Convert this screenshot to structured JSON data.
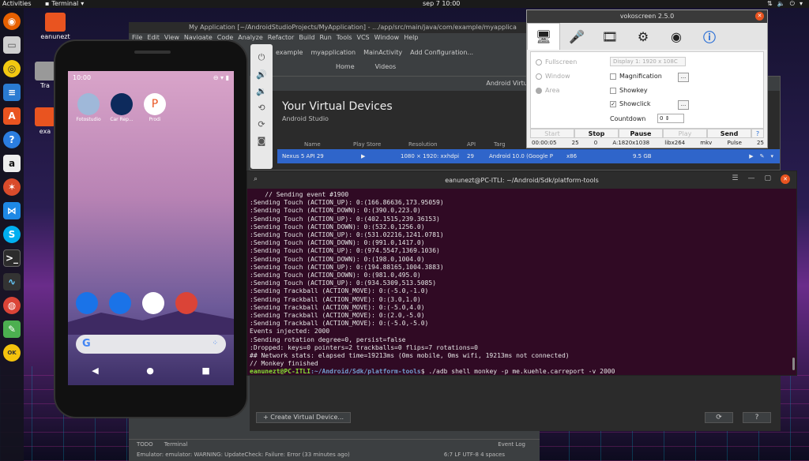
{
  "topbar": {
    "activities": "Activities",
    "terminal_menu": "Terminal",
    "clock": "sep 7  10:00"
  },
  "dock": {
    "items": [
      "firefox",
      "files",
      "rhythmbox",
      "libreoffice-writer",
      "ubuntu-software",
      "help",
      "amazon",
      "gitkraken",
      "vscode",
      "skype",
      "terminal",
      "system-monitor",
      "chrome",
      "notes",
      "whoami"
    ]
  },
  "desktop_icons": {
    "eanunezt": "eanunezt",
    "trash": "Tra",
    "exa": "exa"
  },
  "studio": {
    "title": "My Application [~/AndroidStudioProjects/MyApplication] - .../app/src/main/java/com/example/myapplica",
    "menu": [
      "File",
      "Edit",
      "View",
      "Navigate",
      "Code",
      "Analyze",
      "Refactor",
      "Build",
      "Run",
      "Tools",
      "VCS",
      "Window",
      "Help"
    ],
    "breadcrumb": [
      "example",
      "myapplication",
      "MainActivity",
      "Add Configuration..."
    ],
    "nav": [
      "Home",
      "Videos"
    ],
    "bottom_tabs": [
      "TODO",
      "Terminal"
    ],
    "event_log": "Event Log",
    "status_text": "Emulator: emulator: WARNING: UpdateCheck: Failure: Error (33 minutes ago)",
    "status_right": "6:7  LF  UTF-8  4 spaces"
  },
  "avd": {
    "window_title": "Android Virtual De",
    "heading": "Your Virtual Devices",
    "subheading": "Android Studio",
    "columns": [
      "Name",
      "Play Store",
      "Resolution",
      "API",
      "Targ"
    ],
    "row": {
      "name": "Nexus 5 API 29",
      "resolution": "1080 × 1920: xxhdpi",
      "api": "29",
      "target": "Android 10.0 (Google P",
      "cpu": "x86",
      "size": "9.5 GB"
    },
    "create_button": "+ Create Virtual Device..."
  },
  "phone": {
    "time": "10:00",
    "apps": [
      {
        "label": "Fotostudio"
      },
      {
        "label": "Car Rep..."
      },
      {
        "label": "Prodi"
      }
    ]
  },
  "terminal": {
    "title": "eanunezt@PC-ITLI: ~/Android/Sdk/platform-tools",
    "lines": [
      "    // Sending event #1900",
      ":Sending Touch (ACTION_UP): 0:(166.86636,173.95059)",
      ":Sending Touch (ACTION_DOWN): 0:(390.0,223.0)",
      ":Sending Touch (ACTION_UP): 0:(402.1515,239.36153)",
      ":Sending Touch (ACTION_DOWN): 0:(532.0,1256.0)",
      ":Sending Touch (ACTION_UP): 0:(531.02216,1241.0781)",
      ":Sending Touch (ACTION_DOWN): 0:(991.0,1417.0)",
      ":Sending Touch (ACTION_UP): 0:(974.5547,1369.1036)",
      ":Sending Touch (ACTION_DOWN): 0:(198.0,1004.0)",
      ":Sending Touch (ACTION_UP): 0:(194.88165,1004.3883)",
      ":Sending Touch (ACTION_DOWN): 0:(981.0,495.0)",
      ":Sending Touch (ACTION_UP): 0:(934.5309,513.5085)",
      ":Sending Trackball (ACTION_MOVE): 0:(-5.0,-1.0)",
      ":Sending Trackball (ACTION_MOVE): 0:(3.0,1.0)",
      ":Sending Trackball (ACTION_MOVE): 0:(-5.0,4.0)",
      ":Sending Trackball (ACTION_MOVE): 0:(2.0,-5.0)",
      ":Sending Trackball (ACTION_MOVE): 0:(-5.0,-5.0)",
      "Events injected: 2000",
      ":Sending rotation degree=0, persist=false",
      ":Dropped: keys=0 pointers=2 trackballs=0 flips=7 rotations=0",
      "## Network stats: elapsed time=19213ms (0ms mobile, 0ms wifi, 19213ms not connected)",
      "// Monkey finished"
    ],
    "prompt_user": "eanunezt@PC-ITLI",
    "prompt_path": ":~/Android/Sdk/platform-tools",
    "prompt_cmd": "$ ./adb shell monkey -p me.kuehle.carreport -v 2000"
  },
  "voko": {
    "title": "vokoscreen 2.5.0",
    "options": {
      "fullscreen": "Fullscreen",
      "window": "Window",
      "area": "Area"
    },
    "display_combo": "Display 1:  1920 x 108C",
    "checks": {
      "magnification": "Magnification",
      "showkey": "Showkey",
      "showclick": "Showclick"
    },
    "countdown_label": "Countdown",
    "countdown_value": "0",
    "buttons": [
      "Start",
      "Stop",
      "Pause",
      "Play",
      "Send"
    ],
    "status": {
      "time": "00:00:05",
      "fps": "25",
      "dropped": "0",
      "area": "A:1820x1038",
      "codec": "libx264",
      "container": "mkv",
      "pulse": "Pulse",
      "pulse_val": "25"
    }
  }
}
